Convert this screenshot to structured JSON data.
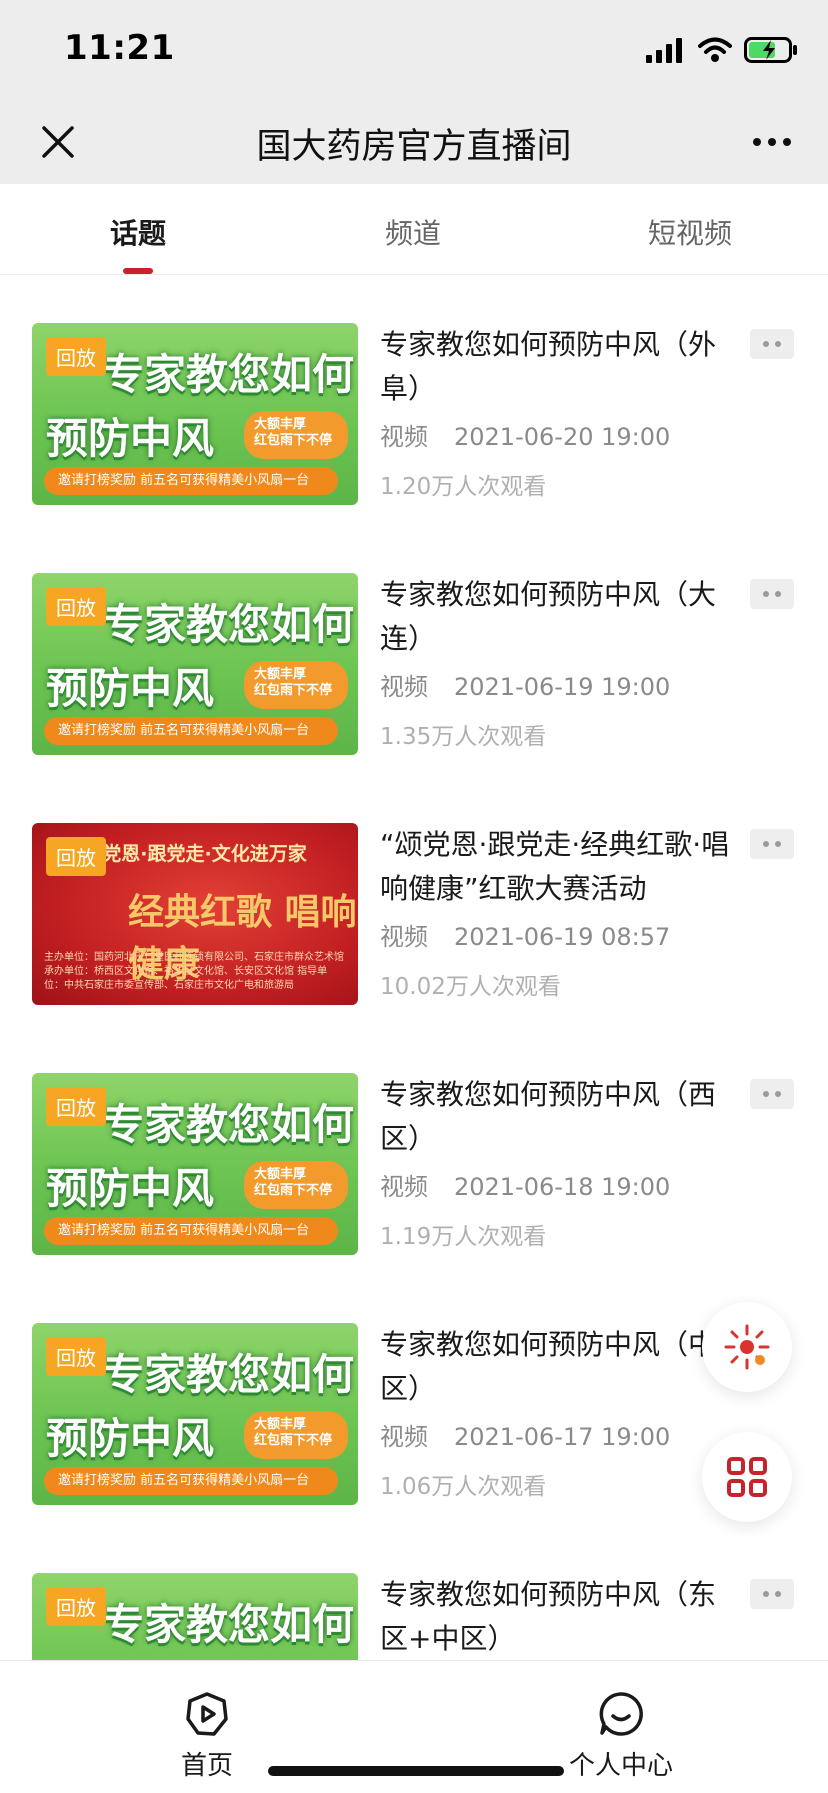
{
  "status": {
    "time": "11:21"
  },
  "nav": {
    "title": "国大药房官方直播间"
  },
  "tabs": [
    {
      "label": "话题"
    },
    {
      "label": "频道"
    },
    {
      "label": "短视频"
    }
  ],
  "items": [
    {
      "badge": "回放",
      "title": "专家教您如何预防中风（外阜）",
      "type": "视频",
      "date": "2021-06-20 19:00",
      "views": "1.20万人次观看"
    },
    {
      "badge": "回放",
      "title": "专家教您如何预防中风（大连）",
      "type": "视频",
      "date": "2021-06-19 19:00",
      "views": "1.35万人次观看"
    },
    {
      "badge": "回放",
      "title": "“颂党恩·跟党走·经典红歌·唱响健康”红歌大赛活动",
      "type": "视频",
      "date": "2021-06-19 08:57",
      "views": "10.02万人次观看"
    },
    {
      "badge": "回放",
      "title": "专家教您如何预防中风（西区）",
      "type": "视频",
      "date": "2021-06-18 19:00",
      "views": "1.19万人次观看"
    },
    {
      "badge": "回放",
      "title": "专家教您如何预防中风（中区）",
      "type": "视频",
      "date": "2021-06-17 19:00",
      "views": "1.06万人次观看"
    },
    {
      "badge": "回放",
      "title": "专家教您如何预防中风（东区+中区）",
      "type": "视频",
      "date": "",
      "views": ""
    }
  ],
  "thumb_green": {
    "line1": "专家教您如何",
    "line2": "预防中风",
    "bubble": "大额丰厚\n红包雨下不停",
    "banner": "邀请打榜奖励  前五名可获得精美小风扇一台"
  },
  "thumb_red": {
    "top": "颂党恩·跟党走·文化进万家",
    "mid": "经典红歌 唱响健康",
    "bot": "主办单位：国药河北乐仁堂医药连锁有限公司、石家庄市群众艺术馆 承办单位：桥西区文化馆、裕华区文化馆、长安区文化馆 指导单位：中共石家庄市委宣传部、石家庄市文化广电和旅游局"
  },
  "bottom_nav": [
    {
      "label": "首页",
      "icon": "play-circle-icon"
    },
    {
      "label": "个人中心",
      "icon": "smiley-icon"
    }
  ],
  "colors": {
    "accent": "#c8232c",
    "badge": "#f6a623",
    "nav_bg": "#ededed"
  }
}
